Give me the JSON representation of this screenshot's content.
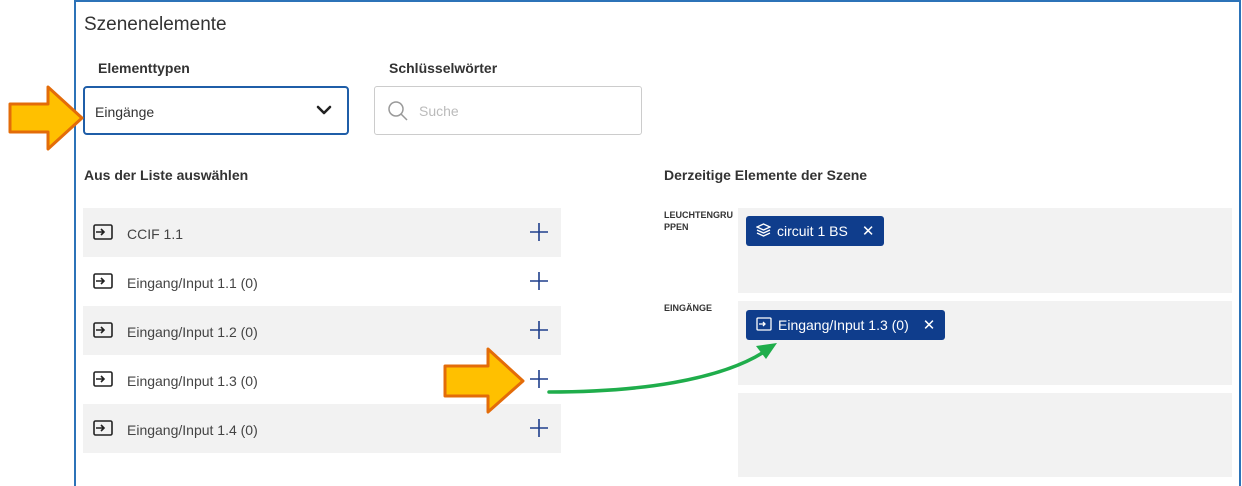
{
  "header": {
    "title": "Szenenelemente"
  },
  "filters": {
    "type_label": "Elementtypen",
    "type_value": "Eingänge",
    "keywords_label": "Schlüsselwörter",
    "search_placeholder": "Suche"
  },
  "available": {
    "heading": "Aus der Liste auswählen",
    "items": [
      {
        "label": "CCIF 1.1"
      },
      {
        "label": "Eingang/Input 1.1 (0)"
      },
      {
        "label": "Eingang/Input 1.2 (0)"
      },
      {
        "label": "Eingang/Input 1.3 (0)"
      },
      {
        "label": "Eingang/Input 1.4 (0)"
      }
    ]
  },
  "current": {
    "heading": "Derzeitige Elemente der Szene",
    "groups": [
      {
        "category": "LEUCHTENGRUPPEN",
        "chips": [
          {
            "label": "circuit 1 BS",
            "icon": "layers-icon"
          }
        ]
      },
      {
        "category": "EINGÄNGE",
        "chips": [
          {
            "label": "Eingang/Input 1.3 (0)",
            "icon": "input-icon"
          }
        ]
      }
    ]
  },
  "colors": {
    "accent": "#1f5ea8",
    "chip": "#0f3d8c",
    "callout_arrow": "#ffc000",
    "callout_outline": "#e36c09",
    "connector": "#1fad4b"
  }
}
